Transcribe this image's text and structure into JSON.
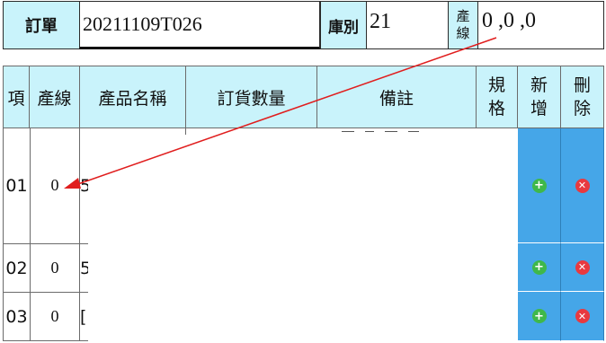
{
  "order_header": {
    "order_label": "訂單",
    "order_value": "20211109T026",
    "warehouse_label": "庫別",
    "warehouse_value": "21",
    "line_label_top": "產",
    "line_label_bottom": "線",
    "line_value": "0 ,0 ,0"
  },
  "table": {
    "columns": {
      "item": "項",
      "line": "產線",
      "product_name": "產品名稱",
      "order_qty": "訂貨數量",
      "remarks": "備註",
      "spec_top": "規",
      "spec_bottom": "格",
      "add_top": "新",
      "add_bottom": "增",
      "delete_top": "刪",
      "delete_bottom": "除"
    },
    "rows": [
      {
        "item": "01",
        "line": "0",
        "product_partial": "5"
      },
      {
        "item": "02",
        "line": "0",
        "product_partial": "5"
      },
      {
        "item": "03",
        "line": "0",
        "product_partial": "["
      }
    ]
  },
  "icons": {
    "add": "plus-circle-icon",
    "delete": "x-circle-icon"
  },
  "annotation_color": "#e01e1e"
}
